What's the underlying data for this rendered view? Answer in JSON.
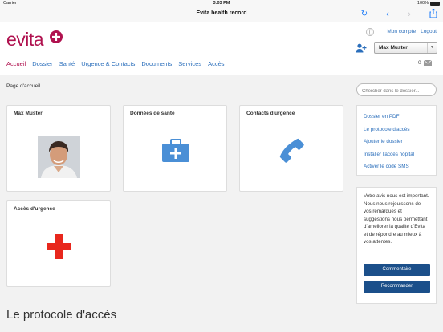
{
  "status_bar": {
    "carrier": "Carrier",
    "time": "3:03 PM",
    "battery": "100%"
  },
  "browser": {
    "title": "Evita health record"
  },
  "brand": {
    "logo_text": "evita",
    "color": "#b0124f",
    "link_color": "#2a6ebb"
  },
  "top_links": {
    "account": "Mon compte",
    "logout": "Logout"
  },
  "user_select": {
    "value": "Max Muster"
  },
  "mail": {
    "count": "0"
  },
  "menu": [
    {
      "label": "Accueil"
    },
    {
      "label": "Dossier"
    },
    {
      "label": "Santé"
    },
    {
      "label": "Urgence & Contacts"
    },
    {
      "label": "Documents"
    },
    {
      "label": "Services"
    },
    {
      "label": "Accès"
    }
  ],
  "breadcrumb": "Page d'accueil",
  "search": {
    "placeholder": "Chercher dans le dossier..."
  },
  "cards": {
    "profile": "Max Muster",
    "health": "Données de santé",
    "contacts": "Contacts d'urgence",
    "emergency": "Accès d'urgence"
  },
  "side_links": [
    "Dossier en PDF",
    "Le protocole d'accès",
    "Ajouter le dossier",
    "Installer l'accès hôpital",
    "Activer le code SMS"
  ],
  "feedback": {
    "text": "Votre avis nous est important. Nous nous réjouissons de vos remarques et suggestions nous permettant d'améliorer la qualité d'Evita et de répondre au mieux à vos attentes.",
    "comment_button": "Commentaire",
    "recommend_button": "Recommander"
  },
  "section_title": "Le protocole d'accès"
}
